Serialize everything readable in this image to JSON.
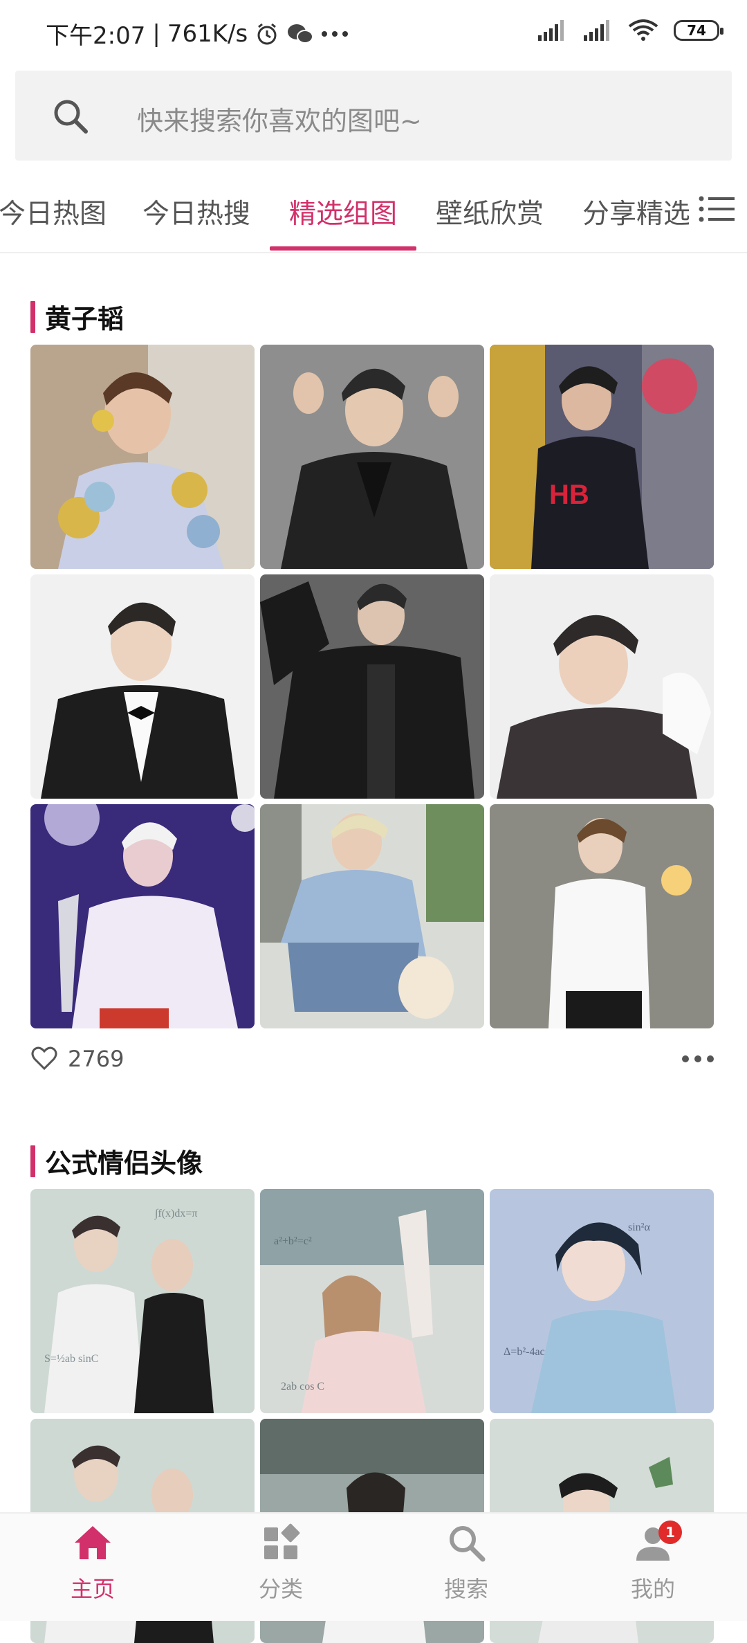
{
  "status_bar": {
    "time": "下午2:07",
    "separator": "|",
    "speed": "761K/s",
    "battery": "74",
    "icons": [
      "alarm-icon",
      "wechat-icon",
      "more-dots-icon",
      "signal-icon",
      "signal-icon",
      "wifi-icon",
      "battery-icon"
    ]
  },
  "search": {
    "placeholder": "快来搜索你喜欢的图吧~"
  },
  "tabs": [
    {
      "label": "今日热图",
      "active": false
    },
    {
      "label": "今日热搜",
      "active": false
    },
    {
      "label": "精选组图",
      "active": true
    },
    {
      "label": "壁纸欣赏",
      "active": false
    },
    {
      "label": "分享精选",
      "active": false
    }
  ],
  "accent_color": "#d2306a",
  "sections": [
    {
      "title": "黄子韬",
      "likes": "2769",
      "images": [
        {
          "subject": "portrait-yellow-flower-shirt"
        },
        {
          "subject": "portrait-black-suit"
        },
        {
          "subject": "portrait-red-hoodie-stage"
        },
        {
          "subject": "portrait-tuxedo-bowtie"
        },
        {
          "subject": "portrait-black-jacket"
        },
        {
          "subject": "portrait-dark-shirt"
        },
        {
          "subject": "portrait-concert-purple"
        },
        {
          "subject": "portrait-denim-with-dog"
        },
        {
          "subject": "portrait-white-shirt-wall"
        }
      ]
    },
    {
      "title": "公式情侣头像",
      "images": [
        {
          "subject": "couple-avatar-formula"
        },
        {
          "subject": "couple-avatar-formula"
        },
        {
          "subject": "anime-avatar-formula"
        },
        {
          "subject": "couple-avatar-formula"
        },
        {
          "subject": "couple-avatar-formula"
        },
        {
          "subject": "couple-avatar-formula"
        }
      ]
    }
  ],
  "bottom_nav": [
    {
      "label": "主页",
      "icon": "home-icon",
      "active": true
    },
    {
      "label": "分类",
      "icon": "category-icon",
      "active": false
    },
    {
      "label": "搜索",
      "icon": "search-icon",
      "active": false
    },
    {
      "label": "我的",
      "icon": "profile-icon",
      "active": false,
      "badge": "1"
    }
  ]
}
